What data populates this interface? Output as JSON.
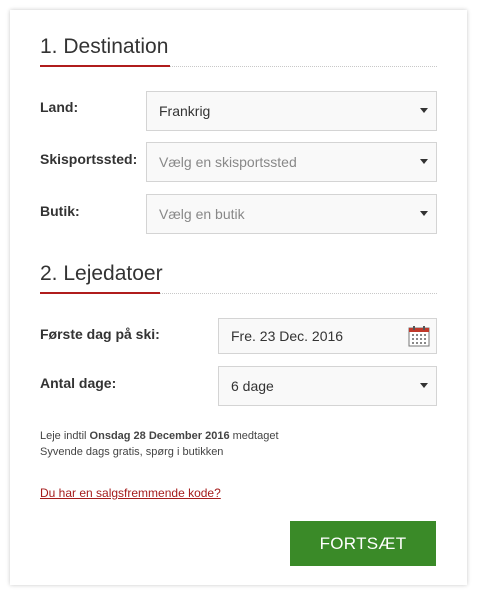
{
  "destination": {
    "title": "1. Destination",
    "country": {
      "label": "Land:",
      "value": "Frankrig"
    },
    "resort": {
      "label": "Skisportssted:",
      "placeholder": "Vælg en skisportssted"
    },
    "shop": {
      "label": "Butik:",
      "placeholder": "Vælg en butik"
    }
  },
  "dates": {
    "title": "2. Lejedatoer",
    "first_day": {
      "label": "Første dag på ski:",
      "value": "Fre. 23 Dec. 2016"
    },
    "num_days": {
      "label": "Antal dage:",
      "value": "6 dage"
    }
  },
  "info": {
    "prefix": "Leje indtil ",
    "end_date": "Onsdag 28 December 2016",
    "suffix": " medtaget",
    "line2": "Syvende dags gratis, spørg i butikken"
  },
  "promo_link": "Du har en salgsfremmende kode?",
  "continue_button": "FORTSÆT",
  "colors": {
    "accent_red": "#b01c1c",
    "button_green": "#3a8a28",
    "link_red": "#a51c1c"
  },
  "icons": {
    "dropdown": "chevron-down-icon",
    "date": "calendar-icon"
  }
}
